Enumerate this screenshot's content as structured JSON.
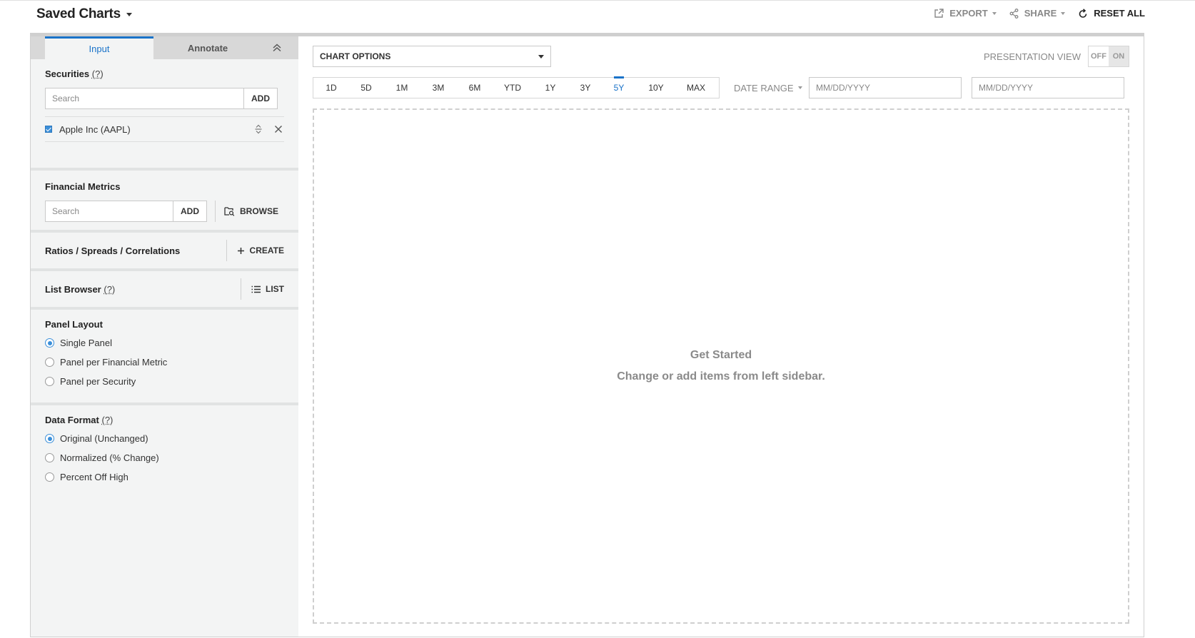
{
  "header": {
    "title": "Saved Charts",
    "export_label": "EXPORT",
    "share_label": "SHARE",
    "reset_label": "RESET ALL"
  },
  "tabs": [
    {
      "label": "Input",
      "active": true
    },
    {
      "label": "Annotate",
      "active": false
    }
  ],
  "securities": {
    "title": "Securities",
    "help": "(?)",
    "search_placeholder": "Search",
    "add_label": "ADD",
    "items": [
      {
        "label": "Apple Inc (AAPL)",
        "checked": true
      }
    ]
  },
  "financial_metrics": {
    "title": "Financial Metrics",
    "search_placeholder": "Search",
    "add_label": "ADD",
    "browse_label": "BROWSE"
  },
  "ratios": {
    "title": "Ratios / Spreads / Correlations",
    "create_label": "CREATE"
  },
  "list_browser": {
    "title": "List Browser",
    "help": "(?)",
    "list_label": "LIST"
  },
  "panel_layout": {
    "title": "Panel Layout",
    "options": [
      {
        "label": "Single Panel",
        "checked": true
      },
      {
        "label": "Panel per Financial Metric",
        "checked": false
      },
      {
        "label": "Panel per Security",
        "checked": false
      }
    ]
  },
  "data_format": {
    "title": "Data Format",
    "help": "(?)",
    "options": [
      {
        "label": "Original (Unchanged)",
        "checked": true
      },
      {
        "label": "Normalized (% Change)",
        "checked": false
      },
      {
        "label": "Percent Off High",
        "checked": false
      }
    ]
  },
  "chart_options": {
    "label": "CHART OPTIONS"
  },
  "presentation_view": {
    "label": "PRESENTATION VIEW",
    "off": "OFF",
    "on": "ON",
    "selected": "ON"
  },
  "time_ranges": {
    "items": [
      "1D",
      "5D",
      "1M",
      "3M",
      "6M",
      "YTD",
      "1Y",
      "3Y",
      "5Y",
      "10Y",
      "MAX"
    ],
    "active": "5Y"
  },
  "date_range": {
    "label": "DATE RANGE",
    "start_placeholder": "MM/DD/YYYY",
    "end_placeholder": "MM/DD/YYYY"
  },
  "empty_state": {
    "title": "Get Started",
    "subtitle": "Change or add items from left sidebar."
  },
  "colors": {
    "accent": "#1a73c9",
    "checkbox": "#3b8fd9",
    "sidebar_bg": "#f3f4f4"
  }
}
